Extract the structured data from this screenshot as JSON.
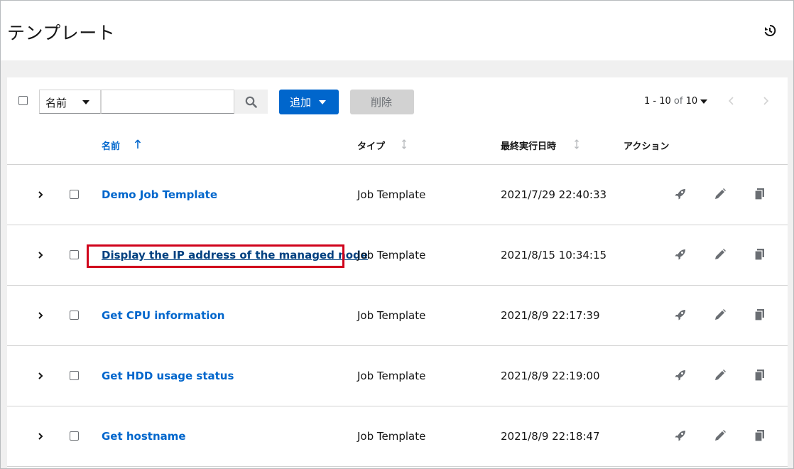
{
  "page": {
    "title": "テンプレート"
  },
  "toolbar": {
    "filter_label": "名前",
    "search_placeholder": "",
    "add_label": "追加",
    "delete_label": "削除",
    "pagination": {
      "range": "1 - 10",
      "of_label": "of",
      "total": "10"
    }
  },
  "columns": {
    "name": "名前",
    "type": "タイプ",
    "last_run": "最終実行日時",
    "actions": "アクション"
  },
  "rows": [
    {
      "name": "Demo Job Template",
      "type": "Job Template",
      "last_run": "2021/7/29 22:40:33"
    },
    {
      "name": "Display the IP address of the managed node",
      "type": "Job Template",
      "last_run": "2021/8/15 10:34:15"
    },
    {
      "name": "Get CPU information",
      "type": "Job Template",
      "last_run": "2021/8/9 22:17:39"
    },
    {
      "name": "Get HDD usage status",
      "type": "Job Template",
      "last_run": "2021/8/9 22:19:00"
    },
    {
      "name": "Get hostname",
      "type": "Job Template",
      "last_run": "2021/8/9 22:18:47"
    }
  ],
  "icons": {
    "history": "history-icon",
    "search": "search-icon",
    "expand": "chevron-right-icon",
    "launch": "rocket-icon",
    "edit": "pencil-icon",
    "copy": "copy-icon"
  },
  "colors": {
    "link": "#0066cc",
    "primary_button": "#0066cc",
    "highlight_box": "#d0021b"
  }
}
